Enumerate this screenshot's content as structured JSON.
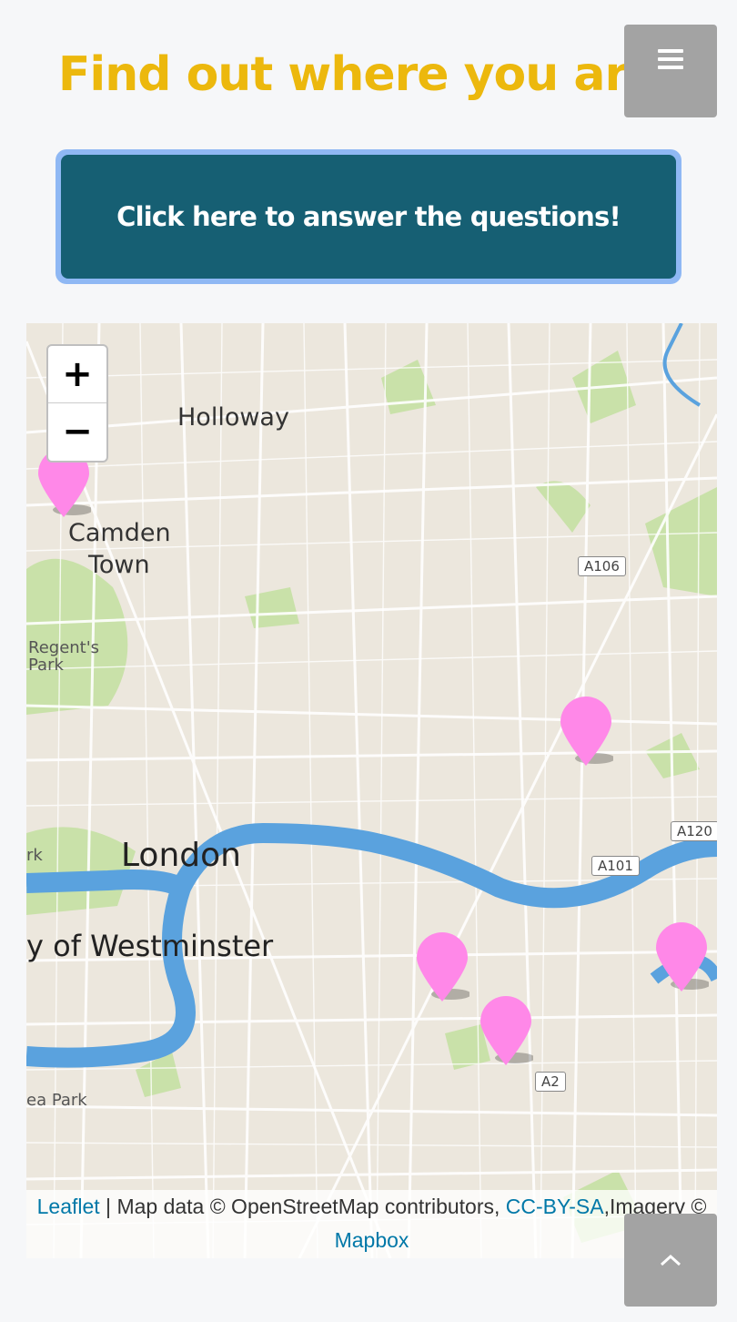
{
  "header": {
    "title": "Find out where you are!",
    "menu_icon": "hamburger-menu-icon"
  },
  "cta": {
    "label": "Click here to answer the questions!"
  },
  "map": {
    "zoom_in_label": "+",
    "zoom_out_label": "−",
    "place_labels": [
      "Holloway",
      "Camden",
      "Town",
      "Regent's",
      "Park",
      "London",
      "y of Westminster",
      "rk",
      "ea Park"
    ],
    "road_labels": [
      "A106",
      "A120",
      "A101",
      "A2"
    ],
    "marker_color": "#ff88e8",
    "marker_count": 5,
    "attribution": {
      "leaflet": "Leaflet",
      "separator": " | ",
      "text1": "Map data © OpenStreetMap contributors, ",
      "license": "CC-BY-SA",
      "text2": ",Imagery © ",
      "mapbox": "Mapbox"
    }
  },
  "scroll_top_icon": "chevron-up-icon",
  "colors": {
    "title": "#ecb80d",
    "cta_bg": "#165f73",
    "cta_border": "#8fb8f4",
    "river": "#5aa2de",
    "link": "#0078a8"
  }
}
